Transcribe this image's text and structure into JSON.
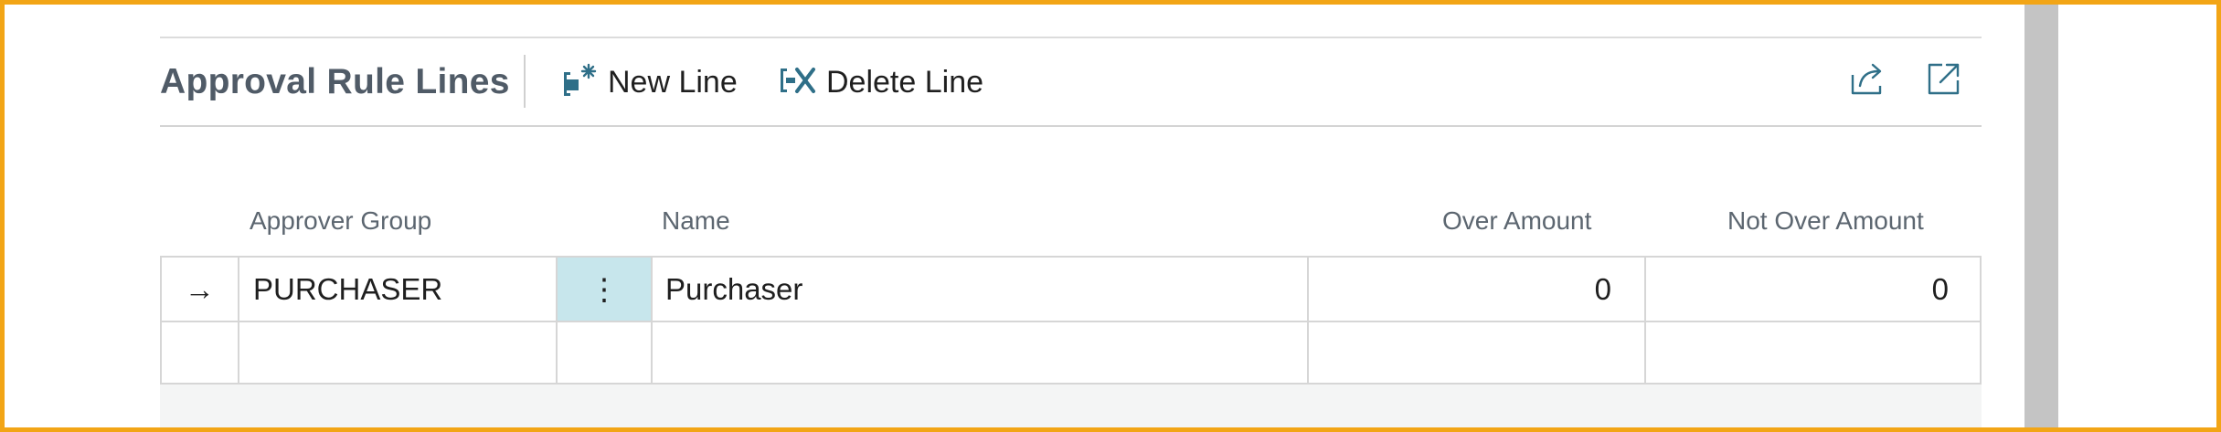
{
  "section": {
    "title": "Approval Rule Lines"
  },
  "actions": {
    "new_line": {
      "label": "New Line",
      "icon": "new-line-icon"
    },
    "delete_line": {
      "label": "Delete Line",
      "icon": "delete-line-icon"
    },
    "share": {
      "icon": "share-icon"
    },
    "expand": {
      "icon": "expand-icon"
    }
  },
  "table": {
    "columns": [
      "Approver Group",
      "Name",
      "Over Amount",
      "Not Over Amount"
    ],
    "rows": [
      {
        "indicator": "→",
        "approver_group": "PURCHASER",
        "menu": "⋮",
        "name": "Purchaser",
        "over_amount": "0",
        "not_over_amount": "0"
      },
      {
        "indicator": "",
        "approver_group": "",
        "menu": "",
        "name": "",
        "over_amount": "",
        "not_over_amount": ""
      }
    ]
  },
  "colors": {
    "accent": "#2f6f88",
    "title": "#505b67",
    "selected_cell": "#c7e6ec",
    "frame": "#f2a516"
  }
}
